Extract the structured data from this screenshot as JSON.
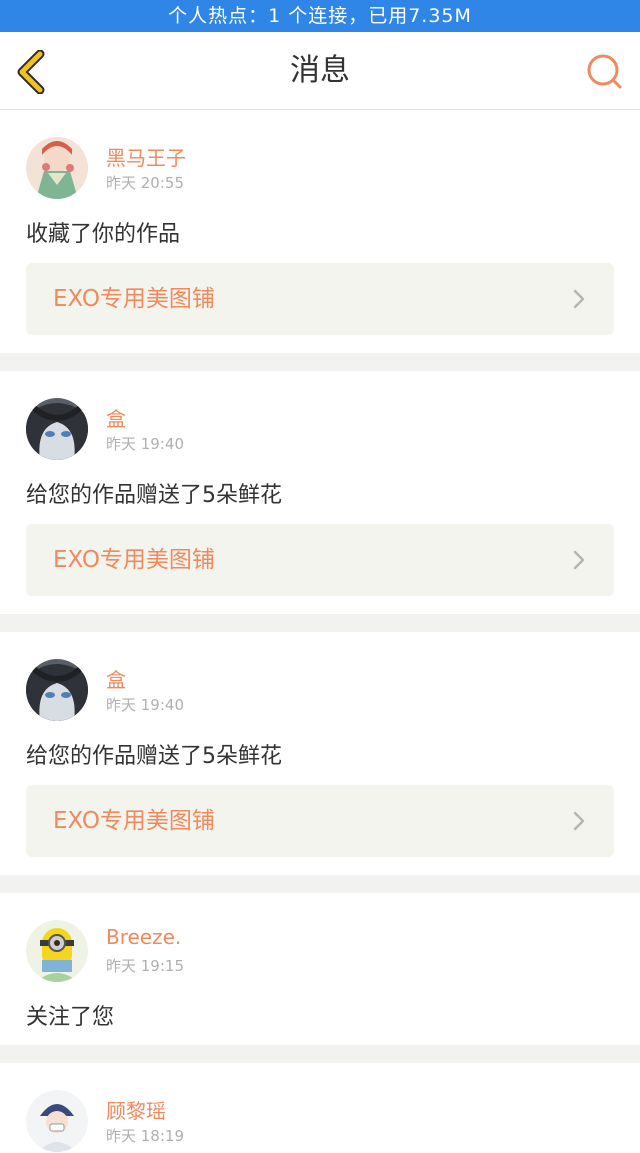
{
  "status_bar": {
    "hotspot_text": "个人热点：1 个连接，已用7.35M"
  },
  "header": {
    "title": "消息",
    "back_icon": "chevron-left-icon",
    "search_icon": "search-icon"
  },
  "colors": {
    "accent": "#f08a5d",
    "back_icon": "#f2c21a",
    "status_bar": "#2f86e6"
  },
  "messages": [
    {
      "username": "黑马王子",
      "time": "昨天 20:55",
      "action": "收藏了你的作品",
      "work_title": "EXO专用美图铺"
    },
    {
      "username": "盒",
      "time": "昨天 19:40",
      "action": "给您的作品赠送了5朵鲜花",
      "work_title": "EXO专用美图铺"
    },
    {
      "username": "盒",
      "time": "昨天 19:40",
      "action": "给您的作品赠送了5朵鲜花",
      "work_title": "EXO专用美图铺"
    },
    {
      "username": "Breeze.",
      "time": "昨天 19:15",
      "action": "关注了您"
    },
    {
      "username": "顾黎瑶",
      "time": "昨天 18:19"
    }
  ]
}
